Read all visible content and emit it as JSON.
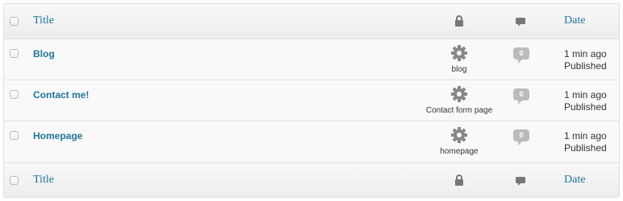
{
  "header": {
    "title_label": "Title",
    "date_label": "Date",
    "lock_icon": "lock-icon",
    "comments_icon": "comment-bubble-icon"
  },
  "footer": {
    "title_label": "Title",
    "date_label": "Date"
  },
  "rows": [
    {
      "title": "Blog",
      "template": "blog",
      "comments": "0",
      "time": "1 min ago",
      "status": "Published"
    },
    {
      "title": "Contact me!",
      "template": "Contact form page",
      "comments": "0",
      "time": "1 min ago",
      "status": "Published"
    },
    {
      "title": "Homepage",
      "template": "homepage",
      "comments": "0",
      "time": "1 min ago",
      "status": "Published"
    }
  ],
  "colors": {
    "link": "#21759b",
    "icon": "#777777",
    "bubble": "#bbbbbb",
    "border": "#dfdfdf"
  }
}
